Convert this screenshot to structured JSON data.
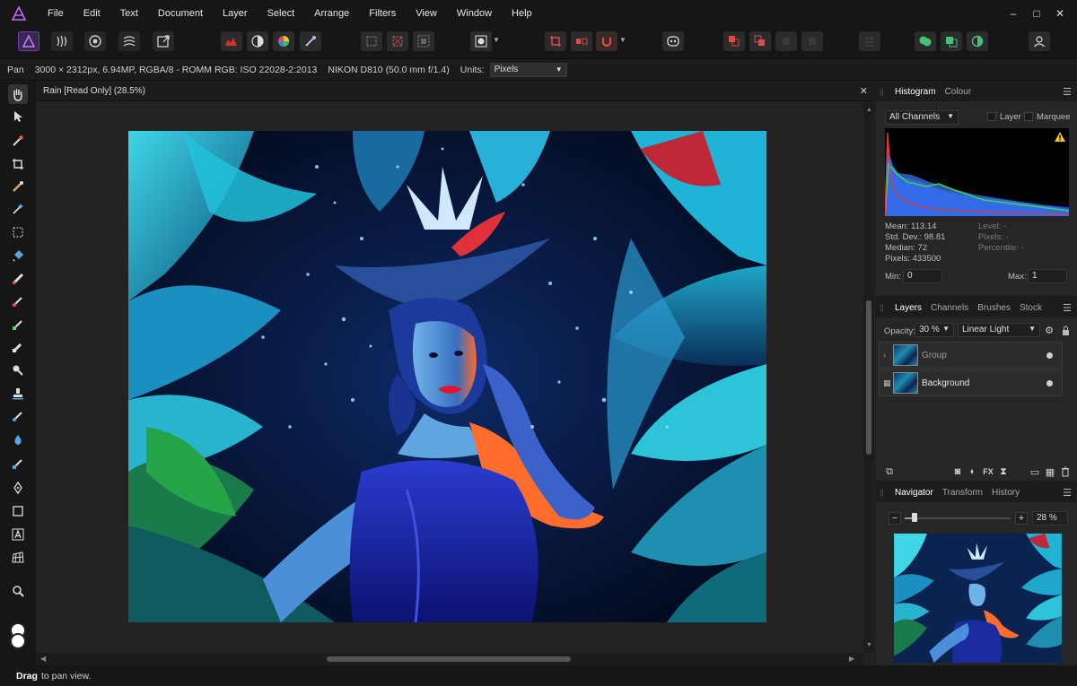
{
  "menubar": {
    "items": [
      "File",
      "Edit",
      "Text",
      "Document",
      "Layer",
      "Select",
      "Arrange",
      "Filters",
      "View",
      "Window",
      "Help"
    ],
    "window_controls": [
      "–",
      "□",
      "✕"
    ]
  },
  "context_toolbar": {
    "tool_name": "Pan",
    "doc_info": "3000 × 2312px, 6.94MP, RGBA/8 - ROMM RGB: ISO 22028-2:2013",
    "camera": "NIKON D810 (50.0 mm f/1.4)",
    "units_label": "Units:",
    "units_value": "Pixels"
  },
  "document": {
    "tab_title": "Rain [Read Only] (28.5%)",
    "close_glyph": "✕"
  },
  "status": {
    "bold": "Drag",
    "text": "to pan view."
  },
  "histogram_panel": {
    "tabs": [
      "Histogram",
      "Colour"
    ],
    "channel": "All Channels",
    "layer_label": "Layer",
    "marquee_label": "Marquee",
    "stats": {
      "mean": "Mean: 113.14",
      "std_dev": "Std. Dev.: 98.81",
      "median": "Median: 72",
      "pixels": "Pixels: 433500",
      "level": "Level: -",
      "pixels_r": "Pixels: -",
      "percentile": "Percentile: -"
    },
    "min_label": "Min:",
    "min_value": "0",
    "max_label": "Max:",
    "max_value": "1"
  },
  "layers_panel": {
    "tabs": [
      "Layers",
      "Channels",
      "Brushes",
      "Stock"
    ],
    "opacity_label": "Opacity:",
    "opacity_value": "30 %",
    "blend_mode": "Linear Light",
    "layers": [
      {
        "name": "Group"
      },
      {
        "name": "Background"
      }
    ]
  },
  "navigator_panel": {
    "tabs": [
      "Navigator",
      "Transform",
      "History"
    ],
    "zoom_value": "28 %",
    "zoom_level": 0.09
  },
  "colors": {
    "accent": "#8d3fd9",
    "panel_bg": "#262626",
    "chrome_bg": "#161616"
  }
}
